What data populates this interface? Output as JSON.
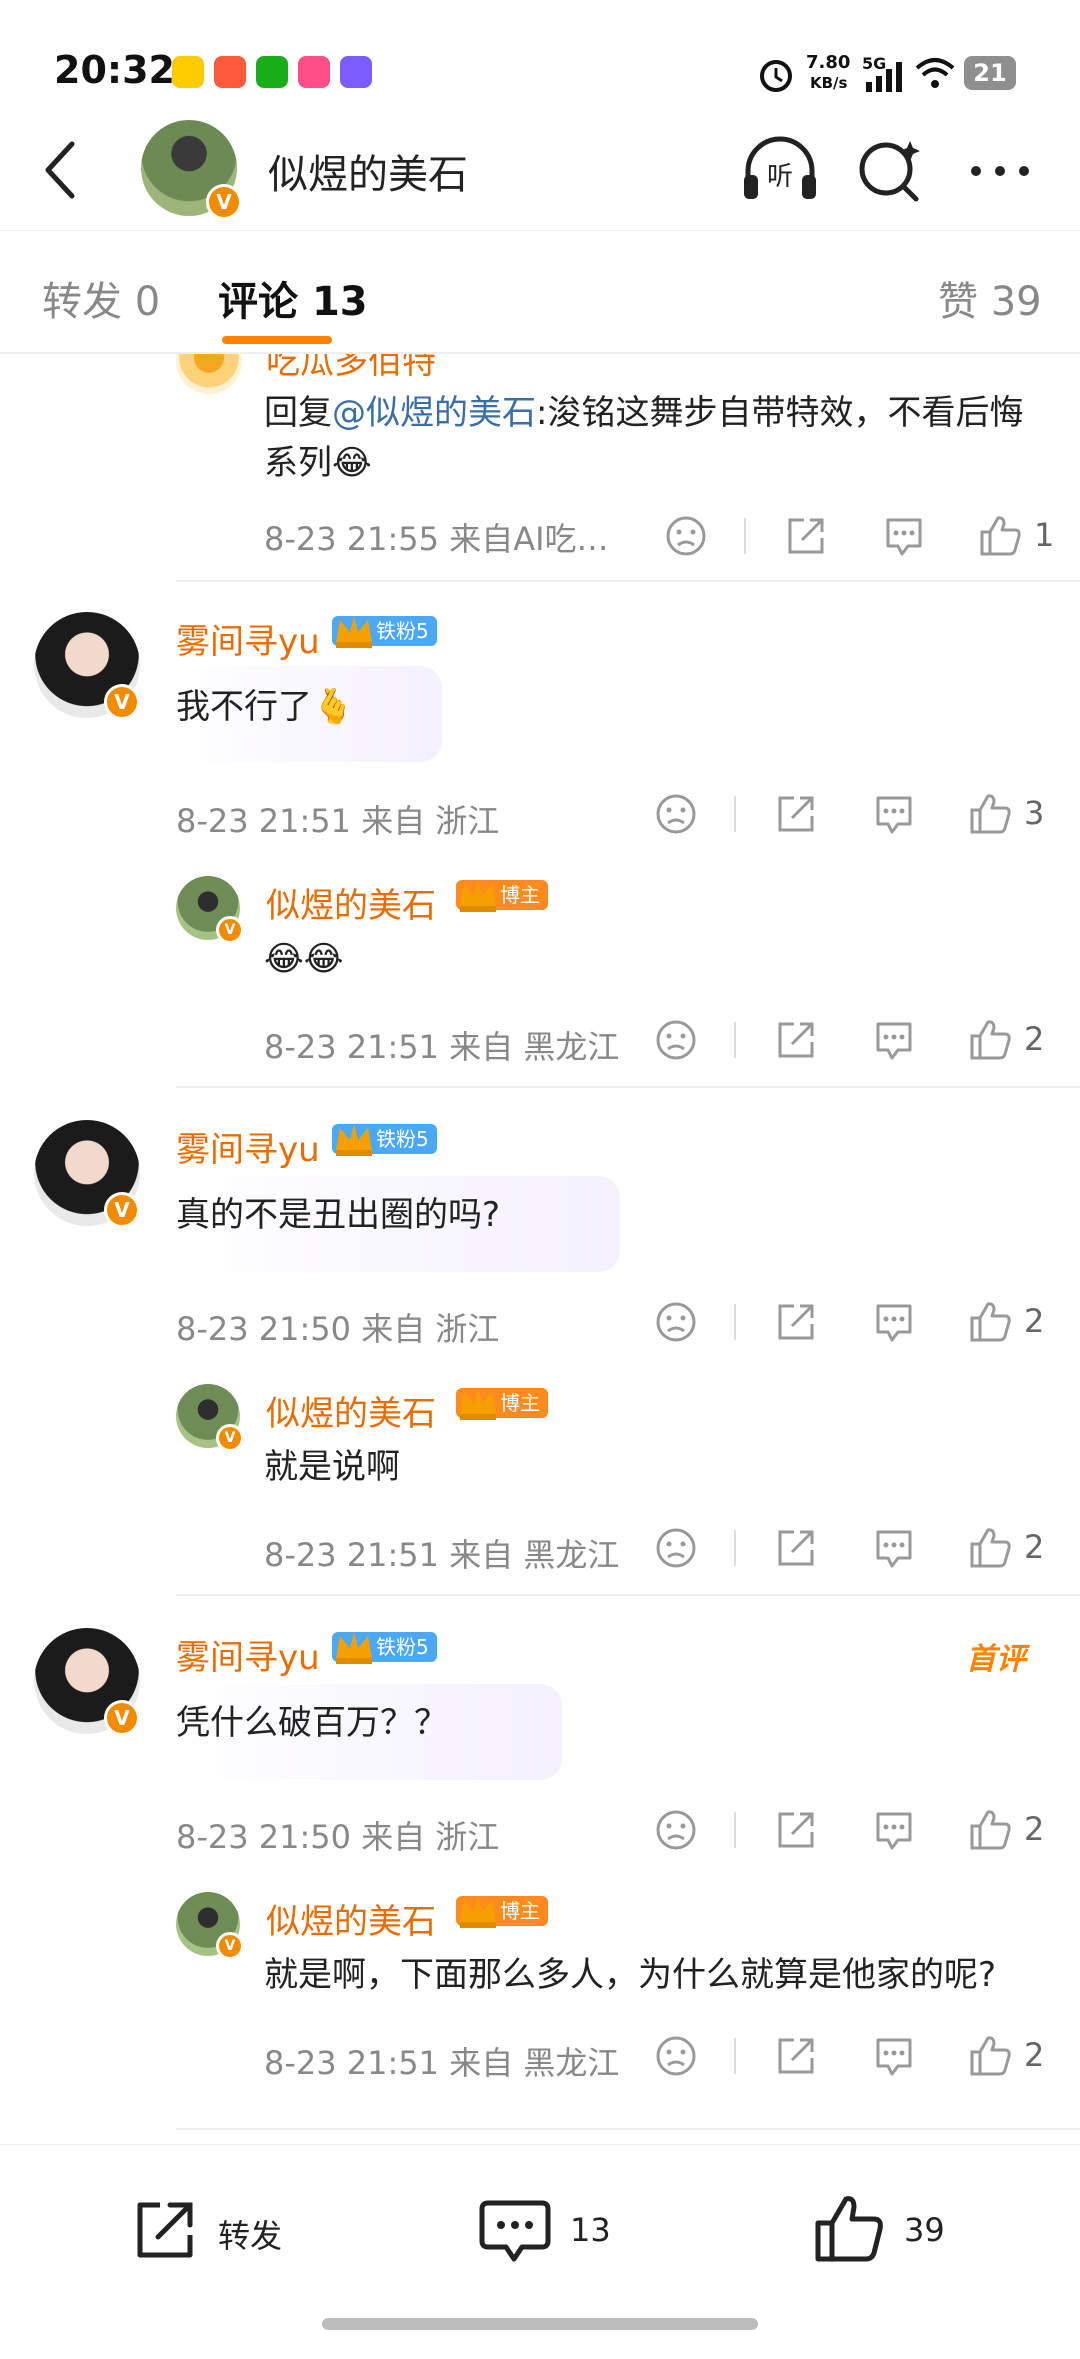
{
  "status_bar": {
    "time": "20:32",
    "net_speed": "7.80",
    "net_unit": "KB/s",
    "network": "5G",
    "battery": "21"
  },
  "header": {
    "title": "似煜的美石"
  },
  "tabs": [
    {
      "label": "转发",
      "count": "0"
    },
    {
      "label": "评论",
      "count": "13"
    },
    {
      "label": "赞",
      "count": "39"
    }
  ],
  "comments": [
    {
      "partial_name": "吃瓜多佰特",
      "text_prefix": "回复",
      "mention": "@似煜的美石",
      "text": ":浚铭这舞步自带特效，不看后悔系列😂",
      "meta": "8-23 21:55  来自AI吃…",
      "likes": "1"
    },
    {
      "name": "雾间寻yu",
      "badge": "铁粉5",
      "text": "我不行了🫰",
      "meta": "8-23 21:51  来自 浙江",
      "likes": "3",
      "reply": {
        "name": "似煜的美石",
        "badge": "博主",
        "text": "😂😂",
        "meta": "8-23 21:51  来自 黑龙江",
        "likes": "2"
      }
    },
    {
      "name": "雾间寻yu",
      "badge": "铁粉5",
      "text": "真的不是丑出圈的吗?",
      "meta": "8-23 21:50  来自 浙江",
      "likes": "2",
      "reply": {
        "name": "似煜的美石",
        "badge": "博主",
        "text": "就是说啊",
        "meta": "8-23 21:51  来自 黑龙江",
        "likes": "2"
      }
    },
    {
      "name": "雾间寻yu",
      "badge": "铁粉5",
      "tag": "首评",
      "text": "凭什么破百万？？",
      "meta": "8-23 21:50  来自 浙江",
      "likes": "2",
      "reply": {
        "name": "似煜的美石",
        "badge": "博主",
        "text": "就是啊，下面那么多人，为什么就算是他家的呢?",
        "meta": "8-23 21:51  来自 黑龙江",
        "likes": "2"
      }
    }
  ],
  "bottom_bar": {
    "repost_label": "转发",
    "comment_count": "13",
    "like_count": "39"
  },
  "colors": {
    "accent": "#ff8200",
    "name": "#e86c00",
    "mention": "#3a6ea5",
    "fan_badge": "#4aa8f5",
    "host_badge": "#ff8a1e"
  }
}
